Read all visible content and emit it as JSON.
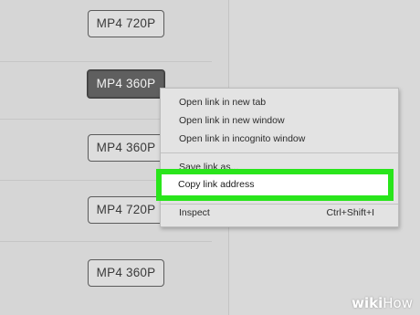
{
  "format_buttons": [
    {
      "label": "MP4 720P"
    },
    {
      "label": "MP4 360P"
    },
    {
      "label": "MP4 360P"
    },
    {
      "label": "MP4 720P"
    },
    {
      "label": "MP4 360P"
    }
  ],
  "context_menu": {
    "items": [
      {
        "label": "Open link in new tab"
      },
      {
        "label": "Open link in new window"
      },
      {
        "label": "Open link in incognito window"
      },
      {
        "label": "Save link as..."
      },
      {
        "label": "Copy link address"
      },
      {
        "label": "Inspect",
        "shortcut": "Ctrl+Shift+I"
      }
    ]
  },
  "highlight_color": "#29e51b",
  "watermark": {
    "bold": "wiki",
    "light": "How"
  }
}
